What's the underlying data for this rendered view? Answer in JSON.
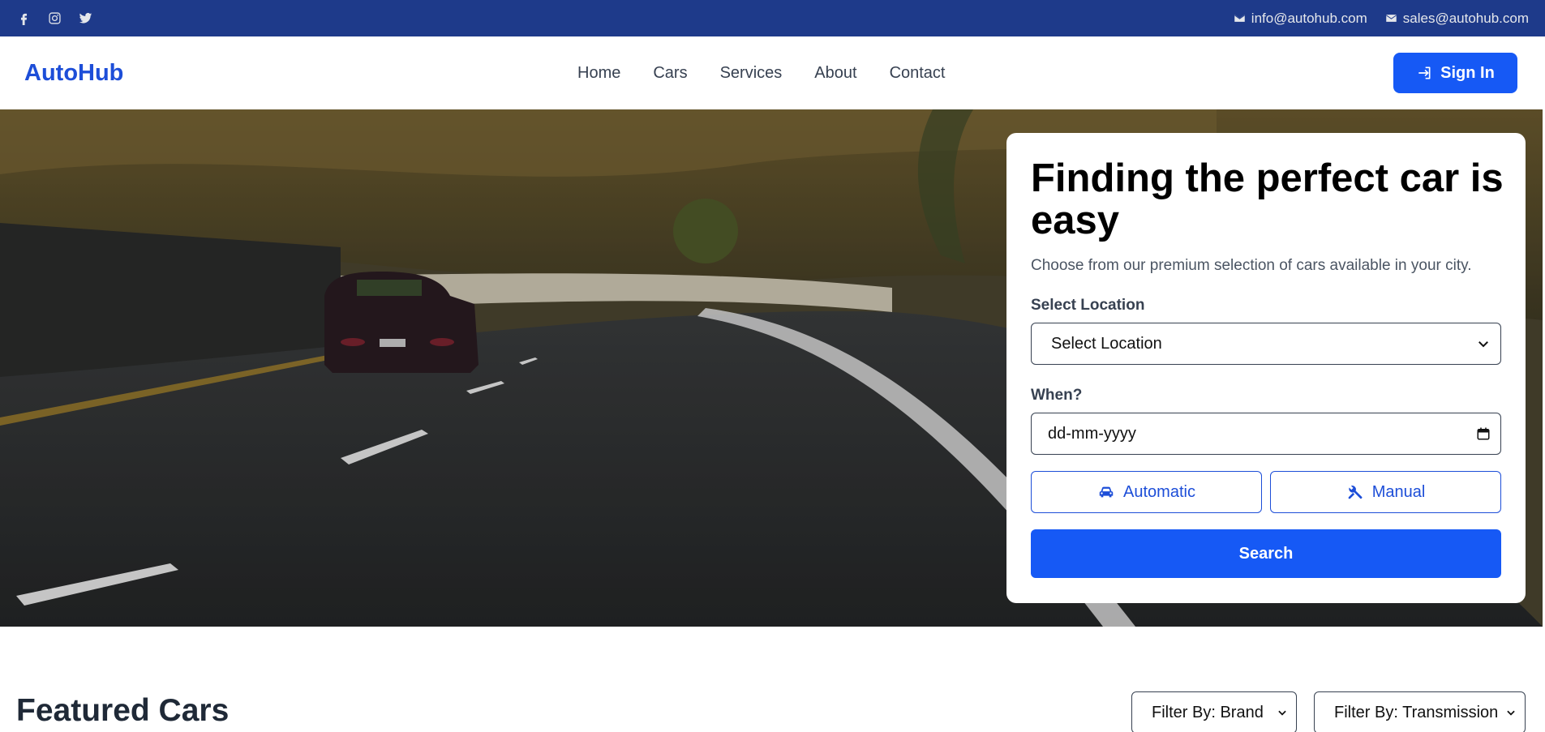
{
  "topbar": {
    "social": [
      "facebook-icon",
      "instagram-icon",
      "twitter-icon"
    ],
    "email_info": "info@autohub.com",
    "email_sales": "sales@autohub.com"
  },
  "navbar": {
    "brand": "AutoHub",
    "links": [
      "Home",
      "Cars",
      "Services",
      "About",
      "Contact"
    ],
    "sign_in": "Sign In"
  },
  "hero": {
    "heading": "Finding the perfect car is easy",
    "subtitle": "Choose from our premium selection of cars available in your city.",
    "location_label": "Select Location",
    "location_selected": "Select Location",
    "when_label": "When?",
    "date_placeholder": "dd-mm-yyyy",
    "automatic_label": "Automatic",
    "manual_label": "Manual",
    "search_label": "Search"
  },
  "featured": {
    "title": "Featured Cars",
    "filter_brand": "Filter By: Brand",
    "filter_transmission": "Filter By: Transmission"
  },
  "colors": {
    "topbar": "#1e3a8a",
    "primary": "#1659f5",
    "brand": "#1d4ed8"
  }
}
